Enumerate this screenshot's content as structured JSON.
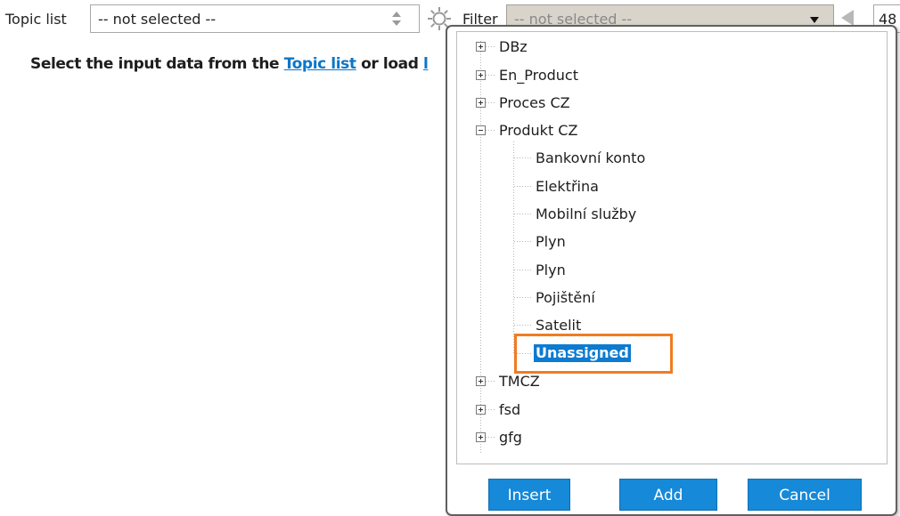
{
  "toolbar": {
    "topic_label": "Topic list",
    "topic_value": "-- not selected --",
    "filter_label": "Filter",
    "filter_value": "-- not selected --",
    "number_value": "48"
  },
  "instruction": {
    "prefix": "Select the input data from the ",
    "link": "Topic list",
    "middle": " or load ",
    "trailing": "l"
  },
  "popup": {
    "tree": {
      "items": [
        {
          "label": "DBz",
          "expanded": false
        },
        {
          "label": "En_Product",
          "expanded": false
        },
        {
          "label": "Proces CZ",
          "expanded": false
        },
        {
          "label": "Produkt CZ",
          "expanded": true,
          "children": [
            {
              "label": "Bankovní konto"
            },
            {
              "label": "Elektřina"
            },
            {
              "label": "Mobilní služby"
            },
            {
              "label": "Plyn"
            },
            {
              "label": "Plyn"
            },
            {
              "label": "Pojištění"
            },
            {
              "label": "Satelit"
            },
            {
              "label": "Unassigned",
              "selected": true
            }
          ]
        },
        {
          "label": "TMCZ",
          "expanded": false
        },
        {
          "label": "fsd",
          "expanded": false
        },
        {
          "label": "gfg",
          "expanded": false
        }
      ]
    },
    "buttons": {
      "insert": "Insert",
      "add": "Add",
      "cancel": "Cancel"
    }
  },
  "colors": {
    "accent": "#1689d8",
    "link": "#0a76c8",
    "selection": "#0c7bd0",
    "highlight": "#f07c22",
    "filter_bg": "#d9d4cb"
  },
  "icons": {
    "gear": "gear-icon",
    "spinner": "up-down-spinner-icon",
    "caret": "caret-down-icon",
    "prev": "triangle-left-icon"
  }
}
